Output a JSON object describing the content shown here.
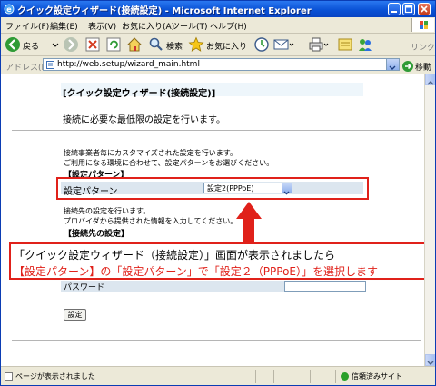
{
  "window": {
    "title": "クイック設定ウィザード(接続設定) - Microsoft Internet Explorer"
  },
  "menu": {
    "items": [
      "ファイル(F)",
      "編集(E)",
      "表示(V)",
      "お気に入り(A)",
      "ツール(T)",
      "ヘルプ(H)"
    ]
  },
  "toolbar": {
    "back_label": "戻る",
    "search_label": "検索",
    "favorites_label": "お気に入り",
    "links_label": "リンク"
  },
  "address": {
    "label": "アドレス(D)",
    "url": "http://web.setup/wizard_main.html",
    "go_label": "移動"
  },
  "page": {
    "title": "[クイック設定ウィザード(接続設定)]",
    "subtitle": "接続に必要な最低限の設定を行います。",
    "desc1_line1": "接続事業者毎にカスタマイズされた設定を行います。",
    "desc1_line2": "ご利用になる環境に合わせて、設定パターンをお選びください。",
    "section1": "【設定パターン】",
    "pattern_label": "設定パターン",
    "pattern_value": "設定2(PPPoE)",
    "desc2_line1": "接続先の設定を行います。",
    "desc2_line2": "プロバイダから提供された情報を入力してください。",
    "section2": "【接続先の設定】",
    "password_label": "パスワード",
    "submit_label": "設定"
  },
  "callout": {
    "line1": "「クイック設定ウィザード（接続設定）」画面が表示されましたら",
    "line2": "【設定パターン】の「設定パターン」で「設定２（PPPoE）」を選択します"
  },
  "status": {
    "text": "ページが表示されました",
    "zone": "信頼済みサイト"
  },
  "colors": {
    "highlight": "#e0211a",
    "title_blue": "#0a52d6"
  }
}
